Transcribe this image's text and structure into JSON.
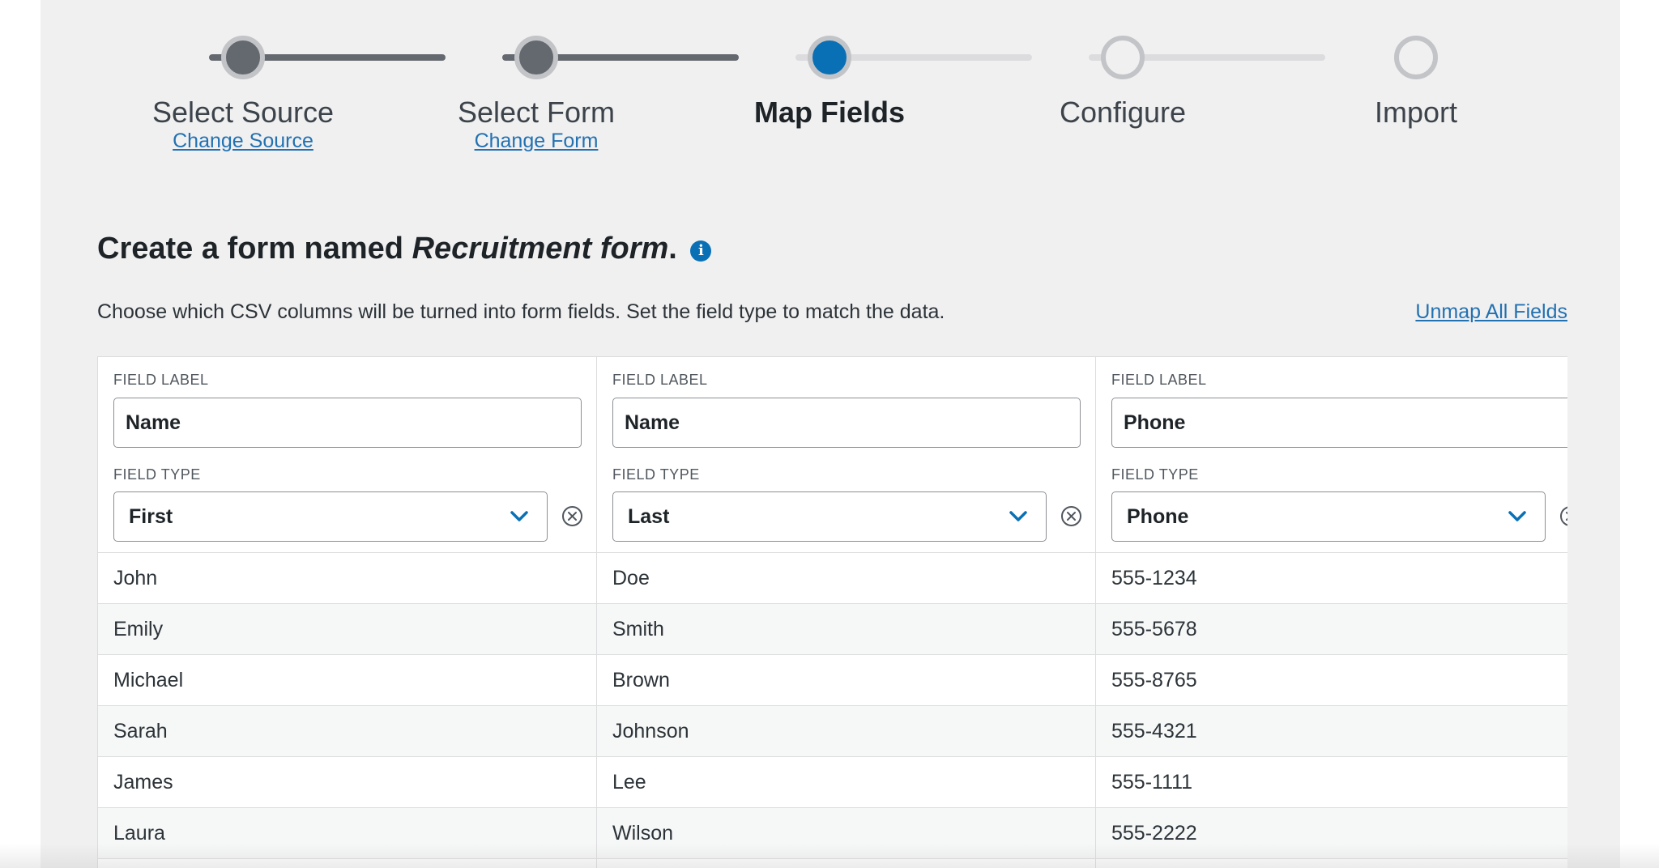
{
  "stepper": {
    "steps": [
      {
        "label": "Select Source",
        "link": "Change Source",
        "state": "done"
      },
      {
        "label": "Select Form",
        "link": "Change Form",
        "state": "done"
      },
      {
        "label": "Map Fields",
        "link": "",
        "state": "current"
      },
      {
        "label": "Configure",
        "link": "",
        "state": "todo"
      },
      {
        "label": "Import",
        "link": "",
        "state": "todo"
      }
    ]
  },
  "heading": {
    "prefix": "Create a form named ",
    "form_name": "Recruitment form",
    "suffix": ".",
    "info_glyph": "i"
  },
  "description": "Choose which CSV columns will be turned into form fields. Set the field type to match the data.",
  "unmap_all_label": "Unmap All Fields",
  "table": {
    "field_label_caption": "FIELD LABEL",
    "field_type_caption": "FIELD TYPE",
    "columns": [
      {
        "label_value": "Name",
        "type_value": "First",
        "cells": [
          "John",
          "Emily",
          "Michael",
          "Sarah",
          "James",
          "Laura"
        ]
      },
      {
        "label_value": "Name",
        "type_value": "Last",
        "cells": [
          "Doe",
          "Smith",
          "Brown",
          "Johnson",
          "Lee",
          "Wilson"
        ]
      },
      {
        "label_value": "Phone",
        "type_value": "Phone",
        "cells": [
          "555-1234",
          "555-5678",
          "555-8765",
          "555-4321",
          "555-1111",
          "555-2222"
        ]
      }
    ]
  },
  "icons": {
    "info": "info-icon",
    "chevron": "chevron-down-icon",
    "remove": "remove-circle-icon"
  },
  "colors": {
    "accent": "#0a70b5",
    "link": "#2271b1",
    "done": "#646970",
    "todo": "#dcdcde"
  }
}
